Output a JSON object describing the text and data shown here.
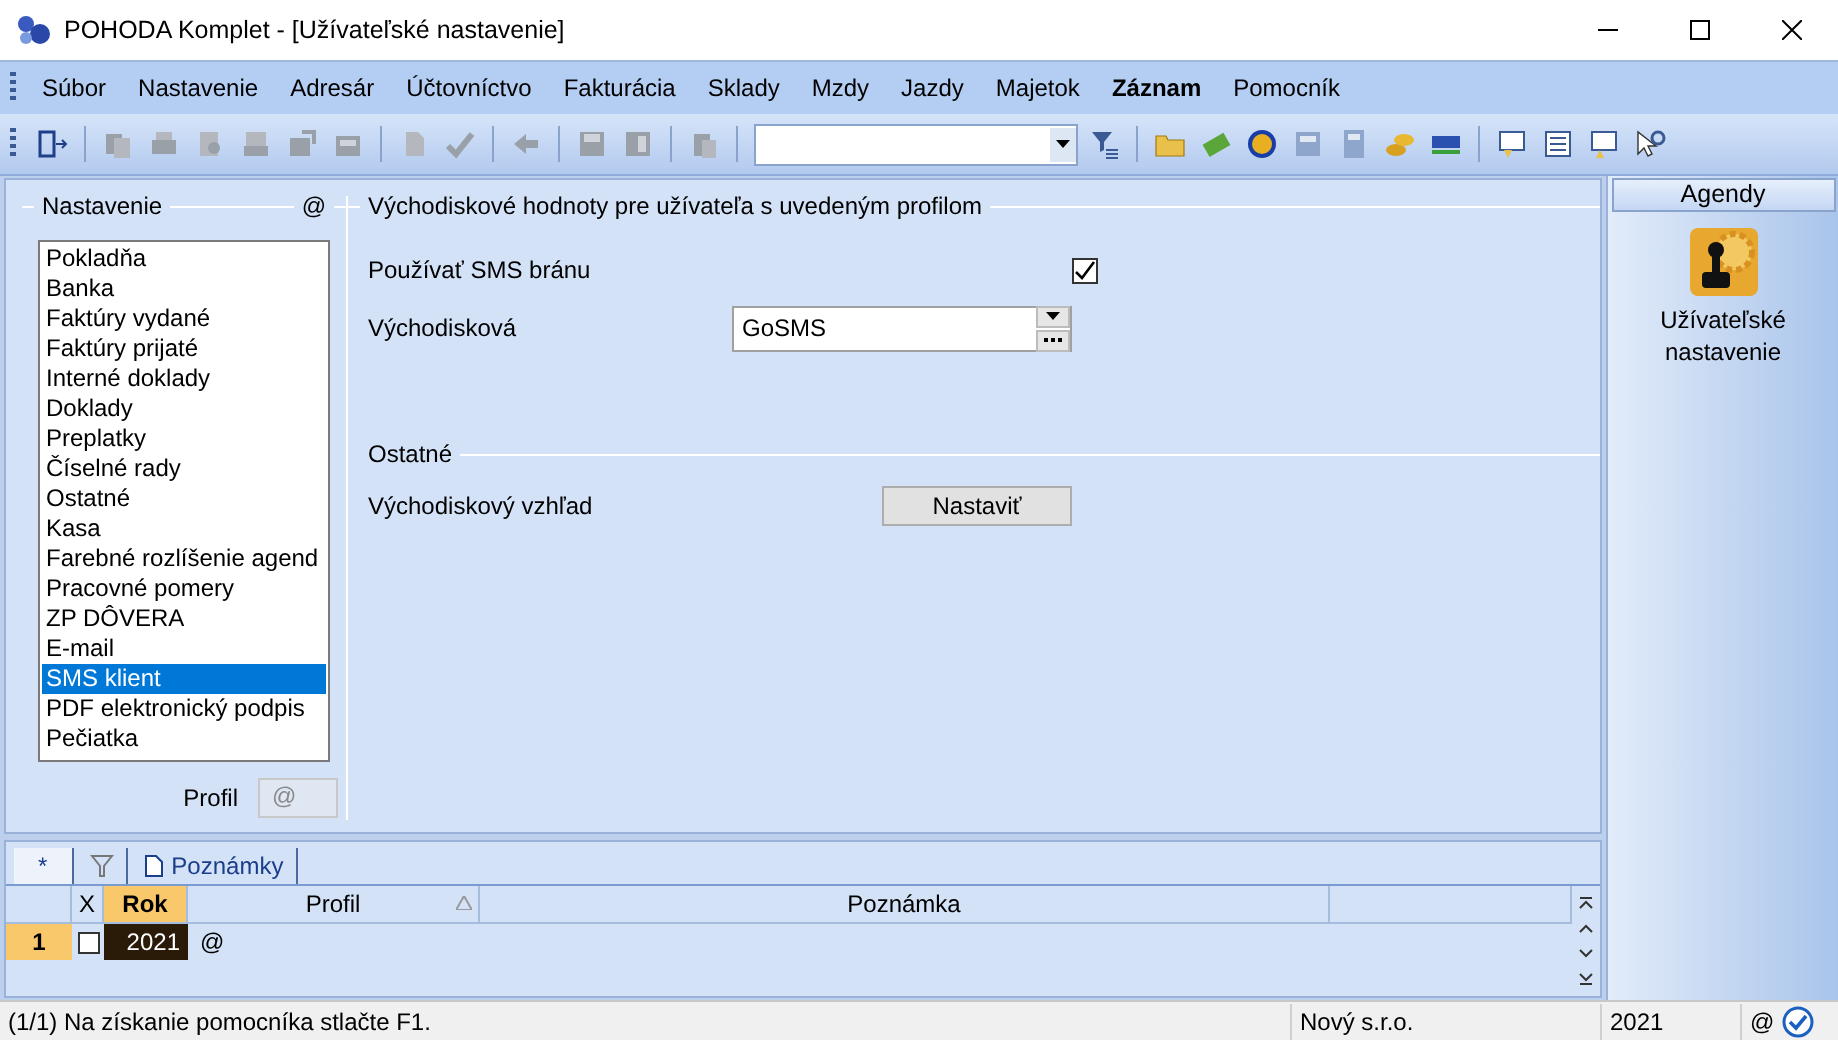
{
  "window": {
    "title": "POHODA Komplet - [Užívateľské nastavenie]"
  },
  "menu": [
    {
      "label": "Súbor",
      "bold": false
    },
    {
      "label": "Nastavenie",
      "bold": false
    },
    {
      "label": "Adresár",
      "bold": false
    },
    {
      "label": "Účtovníctvo",
      "bold": false
    },
    {
      "label": "Fakturácia",
      "bold": false
    },
    {
      "label": "Sklady",
      "bold": false
    },
    {
      "label": "Mzdy",
      "bold": false
    },
    {
      "label": "Jazdy",
      "bold": false
    },
    {
      "label": "Majetok",
      "bold": false
    },
    {
      "label": "Záznam",
      "bold": true
    },
    {
      "label": "Pomocník",
      "bold": false
    }
  ],
  "settings": {
    "title": "Nastavenie",
    "profile_marker": "@",
    "items": [
      {
        "label": "Pokladňa",
        "selected": false
      },
      {
        "label": "Banka",
        "selected": false
      },
      {
        "label": "Faktúry vydané",
        "selected": false
      },
      {
        "label": "Faktúry prijaté",
        "selected": false
      },
      {
        "label": "Interné doklady",
        "selected": false
      },
      {
        "label": "Doklady",
        "selected": false
      },
      {
        "label": "Preplatky",
        "selected": false
      },
      {
        "label": "Číselné rady",
        "selected": false
      },
      {
        "label": "Ostatné",
        "selected": false
      },
      {
        "label": "Kasa",
        "selected": false
      },
      {
        "label": "Farebné rozlíšenie agend",
        "selected": false
      },
      {
        "label": "Pracovné pomery",
        "selected": false
      },
      {
        "label": "ZP DÔVERA",
        "selected": false
      },
      {
        "label": "E-mail",
        "selected": false
      },
      {
        "label": "SMS klient",
        "selected": true
      },
      {
        "label": "PDF elektronický podpis",
        "selected": false
      },
      {
        "label": "Pečiatka",
        "selected": false
      }
    ],
    "profile": {
      "label": "Profil",
      "value": "@"
    }
  },
  "defaults": {
    "title": "Východiskové hodnoty pre užívateľa s uvedeným profilom",
    "use_sms": {
      "label": "Používať SMS bránu",
      "checked": true
    },
    "gateway": {
      "label": "Východisková",
      "value": "GoSMS"
    },
    "other": {
      "title": "Ostatné",
      "view_label": "Východiskový vzhľad",
      "button": "Nastaviť"
    }
  },
  "agenda": {
    "title": "Agendy",
    "item": "Užívateľské nastavenie"
  },
  "bottom_tabs": [
    {
      "kind": "text",
      "label": "*",
      "selected": true
    },
    {
      "kind": "filter",
      "selected": false
    },
    {
      "kind": "document",
      "label": "Poznámky",
      "selected": false
    }
  ],
  "table": {
    "columns": [
      "X",
      "Rok",
      "Profil",
      "Poznámka"
    ],
    "rows": [
      {
        "number": "1",
        "checked": false,
        "rok": "2021",
        "profil": "@",
        "poznamka": ""
      }
    ]
  },
  "status_bar": {
    "message": "(1/1) Na získanie pomocníka stlačte F1.",
    "company": "Nový s.r.o.",
    "year": "2021",
    "profile": "@"
  }
}
